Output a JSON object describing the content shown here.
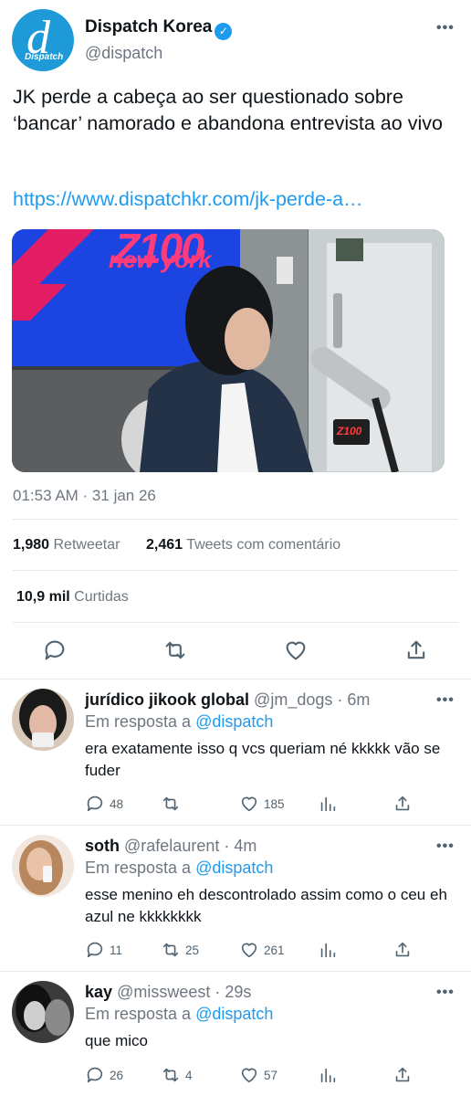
{
  "tweet": {
    "author_name": "Dispatch Korea",
    "author_handle": "@dispatch",
    "avatar_letter": "d",
    "avatar_sub": "Dispatch",
    "text": "JK perde a cabeça ao ser questionado sobre ‘bancar’ namorado e abandona entrevista ao vivo",
    "link": "https://www.dispatchkr.com/jk-perde-a…",
    "media_text_top": "Z100",
    "media_text_city": "new york",
    "mic_label": "Z100",
    "timestamp": "01:53 AM · 31 jan 26",
    "retweets_count": "1,980",
    "retweets_label": "Retweetar",
    "quotes_count": "2,461",
    "quotes_label": "Tweets com comentário",
    "likes_count": "10,9 mil",
    "likes_label": "Curtidas"
  },
  "replies": [
    {
      "name": "jurídico jikook global",
      "handle": "@jm_dogs",
      "time": "· 6m",
      "reply_prefix": "Em resposta a",
      "reply_to": "@dispatch",
      "text": "era exatamente isso q vcs queriam né kkkkk vão se fuder",
      "replies": "48",
      "retweets": "",
      "likes": "185"
    },
    {
      "name": "soth",
      "handle": "@rafelaurent",
      "time": "· 4m",
      "reply_prefix": "Em resposta a",
      "reply_to": "@dispatch",
      "text": "esse menino eh descontrolado assim como o ceu eh azul ne kkkkkkkk",
      "replies": "11",
      "retweets": "25",
      "likes": "261"
    },
    {
      "name": "kay",
      "handle": "@missweest",
      "time": "· 29s",
      "reply_prefix": "Em resposta a",
      "reply_to": "@dispatch",
      "text": "que mico",
      "replies": "26",
      "retweets": "4",
      "likes": "57"
    }
  ],
  "more_glyph": "•••",
  "colors": {
    "accent": "#1d9bf0",
    "muted": "#6e7781",
    "text": "#0f1419"
  }
}
